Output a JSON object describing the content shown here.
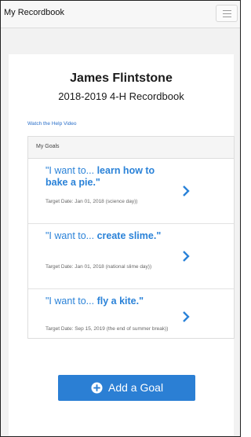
{
  "navbar": {
    "brand": "My Recordbook"
  },
  "header": {
    "user_name": "James Flintstone",
    "recordbook_title": "2018-2019 4-H Recordbook"
  },
  "help_link": "Watch the Help Video",
  "goals_panel": {
    "title": "My Goals",
    "items": [
      {
        "lead": "\"I want to... ",
        "goal": "learn how to bake a pie.\"",
        "target_date": "Target Date: Jan 01, 2018 (science day))"
      },
      {
        "lead": "\"I want to... ",
        "goal": "create slime.\"",
        "target_date": "Target Date: Jan 01, 2018 (national slime day))"
      },
      {
        "lead": "\"I want to... ",
        "goal": "fly a kite.\"",
        "target_date": "Target Date: Sep 15, 2019 (the end of summer break))"
      }
    ]
  },
  "add_goal_button": {
    "label": "Add a Goal",
    "icon": "plus-circle-icon"
  },
  "colors": {
    "accent": "#2b7fd4",
    "link": "#2a6fc9",
    "goal_text": "#2a82d8"
  }
}
